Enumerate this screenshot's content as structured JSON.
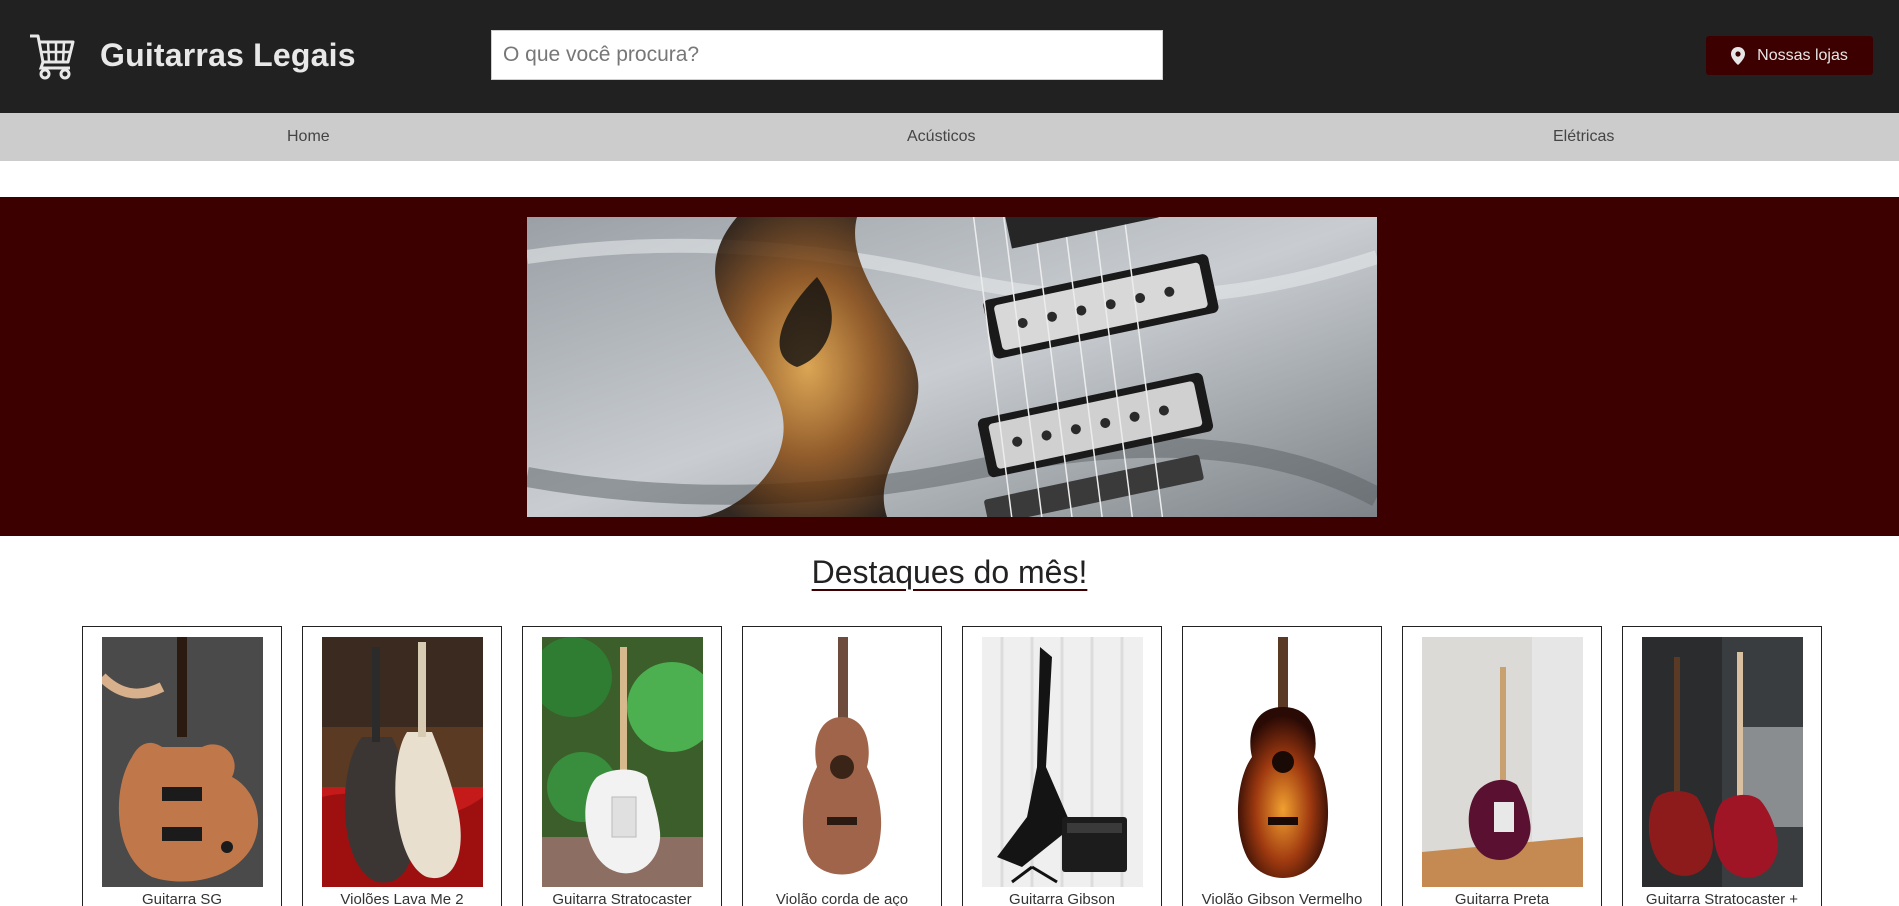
{
  "header": {
    "logo_icon": "shopping-cart-icon",
    "site_title": "Guitarras Legais",
    "search_placeholder": "O que você procura?",
    "stores_button": {
      "icon": "map-pin-icon",
      "label": "Nossas lojas"
    }
  },
  "nav": {
    "items": [
      {
        "label": "Home"
      },
      {
        "label": "Acústicos"
      },
      {
        "label": "Elétricas"
      }
    ]
  },
  "banner": {
    "image": "electric-guitar-pickups-closeup"
  },
  "featured": {
    "title": "Destaques do mês!",
    "products": [
      {
        "name": "Guitarra SG",
        "image": "guitarra-sg-photo"
      },
      {
        "name": "Violões Lava Me 2",
        "image": "violoes-lava-me-2-photo"
      },
      {
        "name": "Guitarra Stratocaster",
        "image": "guitarra-stratocaster-photo"
      },
      {
        "name": "Violão corda de aço",
        "image": "violao-corda-de-aco-photo"
      },
      {
        "name": "Guitarra Gibson",
        "image": "guitarra-gibson-photo"
      },
      {
        "name": "Violão Gibson Vermelho",
        "image": "violao-gibson-vermelho-photo"
      },
      {
        "name": "Guitarra Preta",
        "image": "guitarra-preta-photo"
      },
      {
        "name": "Guitarra Stratocaster +",
        "image": "guitarra-stratocaster-plus-photo"
      }
    ]
  },
  "colors": {
    "header_bg": "#212121",
    "nav_bg": "#cccccc",
    "accent": "#3d0000"
  }
}
